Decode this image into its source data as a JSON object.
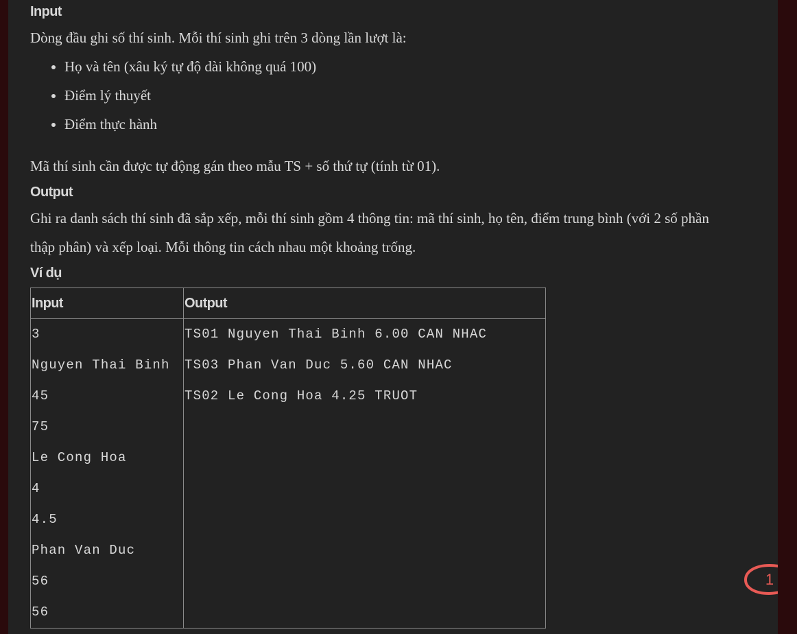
{
  "input_section": {
    "heading": "Input",
    "intro": "Dòng đầu ghi số thí sinh. Mỗi thí sinh ghi trên 3 dòng lần lượt là:",
    "items": [
      "Họ và tên (xâu ký tự độ dài không quá 100)",
      "Điểm lý thuyết",
      "Điểm thực hành"
    ],
    "note": "Mã thí sinh cần được tự động gán theo mẫu TS + số thứ tự (tính từ 01)."
  },
  "output_section": {
    "heading": "Output",
    "line1": "Ghi ra danh sách thí sinh đã sắp xếp, mỗi thí sinh gồm 4 thông tin: mã thí sinh, họ tên, điểm trung bình (với 2 số phần",
    "line2": "thập phân) và xếp loại. Mỗi thông tin cách nhau một khoảng trống."
  },
  "example_section": {
    "heading": "Ví dụ",
    "col_input": "Input",
    "col_output": "Output",
    "input_lines": [
      "3",
      "Nguyen Thai Binh",
      "45",
      "75",
      "Le Cong Hoa",
      "4",
      "4.5",
      "Phan Van Duc",
      "56",
      "56"
    ],
    "output_lines": [
      "TS01 Nguyen Thai Binh 6.00 CAN NHAC",
      "TS03 Phan Van Duc 5.60 CAN NHAC",
      "TS02 Le Cong Hoa 4.25 TRUOT"
    ]
  },
  "chat_widget": {
    "count": "1",
    "icon": "speech-bubble-icon",
    "color": "#e85a55"
  }
}
